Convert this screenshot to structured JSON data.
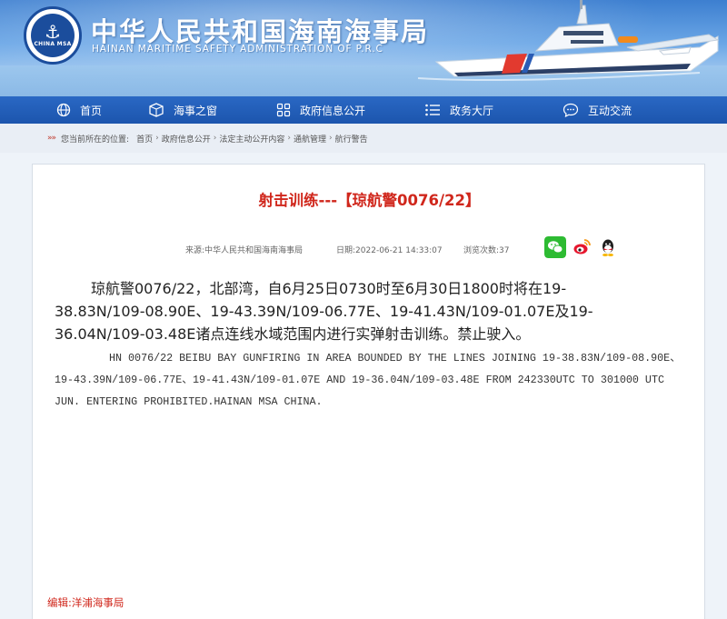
{
  "header": {
    "title": "中华人民共和国海南海事局",
    "subtitle": "HAINAN MARITIME SAFETY ADMINISTRATION OF P.R.C",
    "logo_text": "CHINA MSA"
  },
  "nav": {
    "items": [
      {
        "label": "首页",
        "icon": "globe-icon"
      },
      {
        "label": "海事之窗",
        "icon": "window-icon"
      },
      {
        "label": "政府信息公开",
        "icon": "grid-icon"
      },
      {
        "label": "政务大厅",
        "icon": "list-icon"
      },
      {
        "label": "互动交流",
        "icon": "chat-icon"
      }
    ]
  },
  "breadcrumb": {
    "prefix": "您当前所在的位置:",
    "items": [
      "首页",
      "政府信息公开",
      "法定主动公开内容",
      "通航管理",
      "航行警告"
    ]
  },
  "article": {
    "title": "射击训练---【琼航警0076/22】",
    "source_label": "来源:",
    "source": "中华人民共和国海南海事局",
    "date_label": "日期:",
    "date": "2022-06-21 14:33:07",
    "views_label": "浏览次数:",
    "views": "37",
    "body_cn": "琼航警0076/22，北部湾，自6月25日0730时至6月30日1800时将在19-38.83N/109-08.90E、19-43.39N/109-06.77E、19-41.43N/109-01.07E及19-36.04N/109-03.48E诸点连线水域范围内进行实弹射击训练。禁止驶入。",
    "body_en": "HN 0076/22 BEIBU BAY GUNFIRING IN AREA BOUNDED BY THE LINES JOINING 19-38.83N/109-08.90E、19-43.39N/109-06.77E、19-41.43N/109-01.07E AND 19-36.04N/109-03.48E FROM 242330UTC TO 301000 UTC JUN. ENTERING PROHIBITED.HAINAN MSA CHINA.",
    "editor_label": "编辑:",
    "editor": "洋浦海事局"
  },
  "share": [
    "wechat-icon",
    "weibo-icon",
    "qq-icon"
  ],
  "colors": {
    "nav_bg": "#1c55ad",
    "title_red": "#d0271c",
    "breadcrumb_bg": "#e9eef5"
  }
}
